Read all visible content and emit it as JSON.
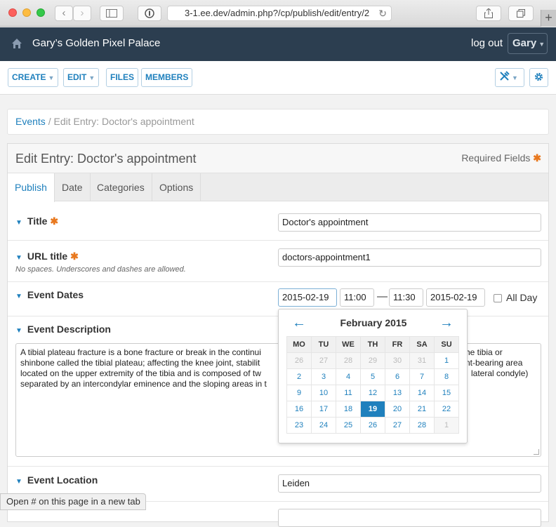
{
  "browser": {
    "url": "3-1.ee.dev/admin.php?/cp/publish/edit/entry/2",
    "back_glyph": "‹",
    "forward_glyph": "›",
    "new_tab_glyph": "+"
  },
  "header": {
    "site_name": "Gary’s Golden Pixel Palace",
    "logout": "log out",
    "user": "Gary"
  },
  "toolbar": {
    "create": "CREATE",
    "edit": "EDIT",
    "files": "FILES",
    "members": "MEMBERS"
  },
  "breadcrumb": {
    "link": "Events",
    "separator": " / ",
    "current": "Edit Entry: Doctor's appointment"
  },
  "panel": {
    "title": "Edit Entry: Doctor's appointment",
    "required_label": "Required Fields",
    "required_marker": "✱",
    "tabs": [
      "Publish",
      "Date",
      "Categories",
      "Options"
    ]
  },
  "fields": {
    "title": {
      "label": "Title",
      "value": "Doctor's appointment"
    },
    "url_title": {
      "label": "URL title",
      "note": "No spaces. Underscores and dashes are allowed.",
      "value": "doctors-appointment1"
    },
    "event_dates": {
      "label": "Event Dates",
      "start_date": "2015-02-19",
      "start_time": "11:00",
      "separator": "—",
      "end_time": "11:30",
      "end_date": "2015-02-19",
      "all_day": "All Day"
    },
    "event_description": {
      "label": "Event Description",
      "lines": [
        "A tibial plateau fracture is a bone fracture or break in the continui",
        "shinbone called the tibial plateau; affecting the knee joint, stabilit",
        "located on the upper extremity of the tibia and is composed of tw",
        "separated by an intercondylar eminence and the sloping areas in t"
      ],
      "right_fragments": [
        "he tibia or",
        "nt-bearing area",
        "lateral condyle)"
      ]
    },
    "event_location": {
      "label": "Event Location",
      "value": "Leiden"
    }
  },
  "datepicker": {
    "month": "February 2015",
    "prev": "←",
    "next": "→",
    "weekdays": [
      "MO",
      "TU",
      "WE",
      "TH",
      "FR",
      "SA",
      "SU"
    ],
    "weeks": [
      [
        "26",
        "27",
        "28",
        "29",
        "30",
        "31",
        "1"
      ],
      [
        "2",
        "3",
        "4",
        "5",
        "6",
        "7",
        "8"
      ],
      [
        "9",
        "10",
        "11",
        "12",
        "13",
        "14",
        "15"
      ],
      [
        "16",
        "17",
        "18",
        "19",
        "20",
        "21",
        "22"
      ],
      [
        "23",
        "24",
        "25",
        "26",
        "27",
        "28",
        "1"
      ]
    ],
    "selected": "19"
  },
  "status_tip": "Open # on this page in a new tab",
  "colors": {
    "accent": "#1f80bd",
    "header": "#2c3e50",
    "required": "#e8781e"
  }
}
